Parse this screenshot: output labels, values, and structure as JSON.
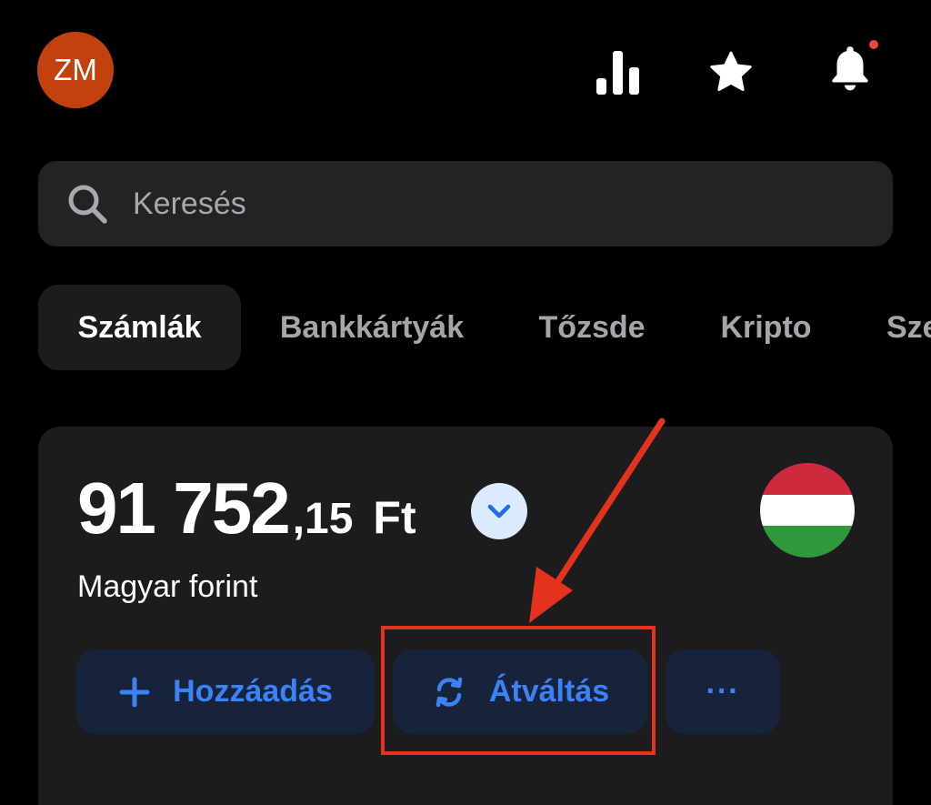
{
  "header": {
    "avatar_initials": "ZM",
    "avatar_color": "#c2410c",
    "icons": [
      "stats-icon",
      "star-icon",
      "bell-icon"
    ],
    "notification_dot_color": "#ef4444"
  },
  "search": {
    "placeholder": "Keresés",
    "icon": "search-icon"
  },
  "tabs": [
    {
      "label": "Számlák",
      "active": true
    },
    {
      "label": "Bankkártyák",
      "active": false
    },
    {
      "label": "Tőzsde",
      "active": false
    },
    {
      "label": "Kripto",
      "active": false
    },
    {
      "label": "Sze",
      "active": false
    }
  ],
  "account": {
    "balance_main": "91 752",
    "balance_decimal": ",15",
    "currency_symbol": "Ft",
    "currency_name": "Magyar forint",
    "flag": "hungary-flag-icon",
    "flag_colors": [
      "#cd2a3e",
      "#ffffff",
      "#2f9a3b"
    ]
  },
  "actions": {
    "add_label": "Hozzáadás",
    "exchange_label": "Átváltás",
    "more_label": "···"
  },
  "colors": {
    "accent": "#3b82f6",
    "action_bg": "#17233a",
    "card_bg": "#1c1c1e",
    "annotation": "#e5321c"
  }
}
